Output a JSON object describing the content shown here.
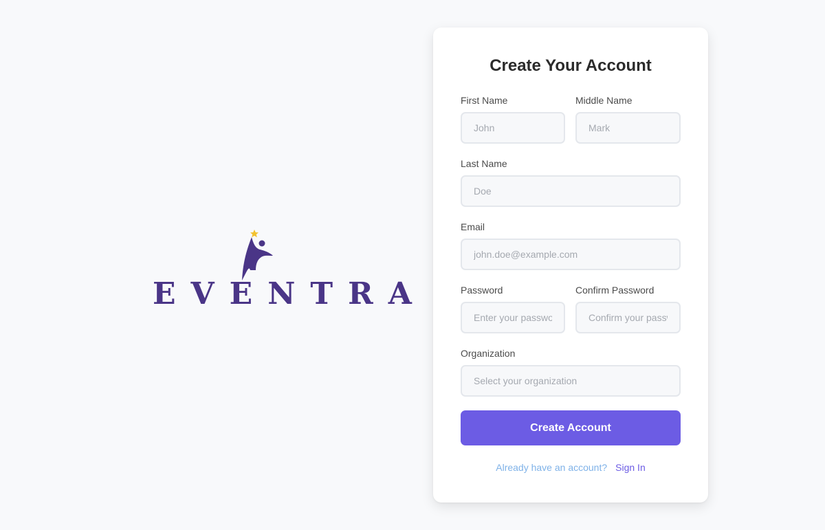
{
  "brand": {
    "name": "EVENTRA",
    "colors": {
      "primary": "#4a3587",
      "star": "#f2c230"
    }
  },
  "form": {
    "title": "Create Your Account",
    "fields": {
      "first_name": {
        "label": "First Name",
        "placeholder": "John",
        "value": ""
      },
      "middle_name": {
        "label": "Middle Name",
        "placeholder": "Mark",
        "value": ""
      },
      "last_name": {
        "label": "Last Name",
        "placeholder": "Doe",
        "value": ""
      },
      "email": {
        "label": "Email",
        "placeholder": "john.doe@example.com",
        "value": ""
      },
      "password": {
        "label": "Password",
        "placeholder": "Enter your password",
        "value": ""
      },
      "confirm_password": {
        "label": "Confirm Password",
        "placeholder": "Confirm your password",
        "value": ""
      },
      "organization": {
        "label": "Organization",
        "placeholder": "Select your organization",
        "value": ""
      }
    },
    "submit_label": "Create Account",
    "signin_prompt": "Already have an account?",
    "signin_link": "Sign In"
  },
  "colors": {
    "accent": "#6c5ce4",
    "background": "#f8f9fb",
    "card": "#ffffff",
    "prompt_text": "#7fb2e8"
  }
}
